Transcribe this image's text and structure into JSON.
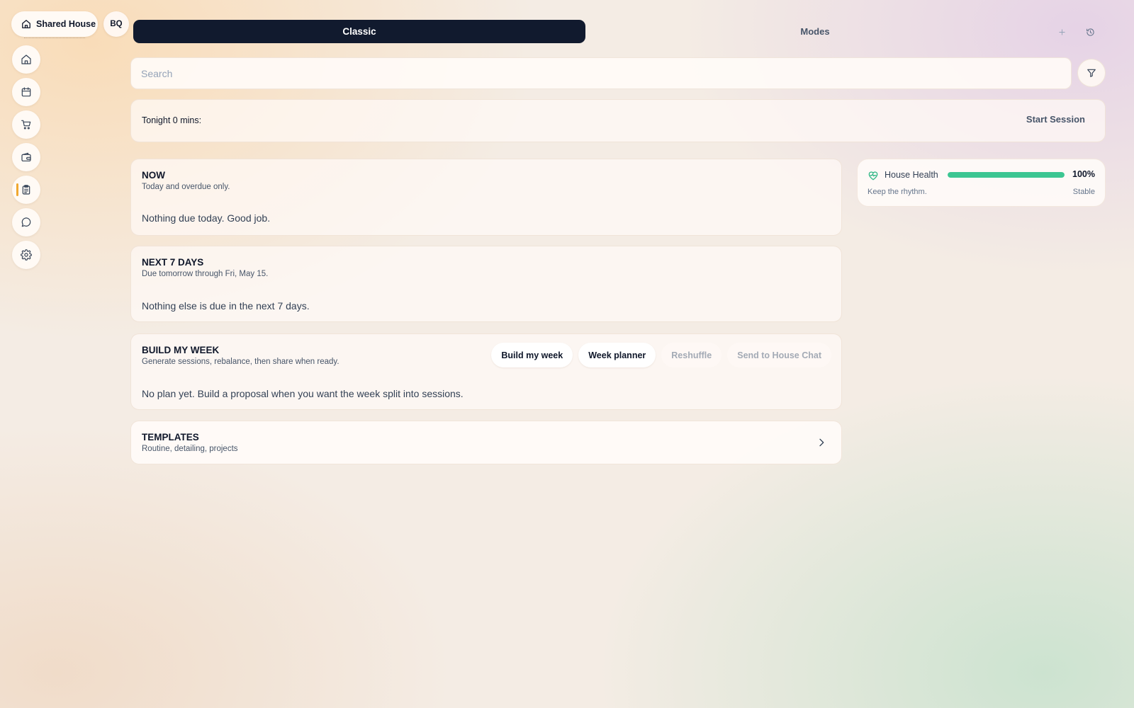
{
  "workspace": {
    "name": "Shared House",
    "avatar_initials": "BQ"
  },
  "sidebar": {
    "items": [
      {
        "id": "home",
        "icon": "home-icon",
        "active": false
      },
      {
        "id": "calendar",
        "icon": "calendar-icon",
        "active": false
      },
      {
        "id": "shopping",
        "icon": "cart-icon",
        "active": false
      },
      {
        "id": "wallet",
        "icon": "wallet-icon",
        "active": false
      },
      {
        "id": "chores",
        "icon": "clipboard-icon",
        "active": true
      },
      {
        "id": "chat",
        "icon": "chat-bubble-icon",
        "active": false
      },
      {
        "id": "settings",
        "icon": "gear-icon",
        "active": false
      }
    ],
    "active_indicator_color": "#f0a830"
  },
  "topbar": {
    "classic_label": "Classic",
    "modes_label": "Modes",
    "plus_icon": "plus-icon",
    "history_icon": "history-icon"
  },
  "search": {
    "placeholder": "Search",
    "value": "",
    "filter_icon": "filter-icon"
  },
  "tonight": {
    "label": "Tonight 0 mins:",
    "action_label": "Start Session"
  },
  "sections": {
    "now": {
      "title": "NOW",
      "subtitle": "Today and overdue only.",
      "body": "Nothing due today. Good job."
    },
    "next7": {
      "title": "NEXT 7 DAYS",
      "subtitle": "Due tomorrow through Fri, May 15.",
      "body": "Nothing else is due in the next 7 days."
    },
    "build": {
      "title": "BUILD MY WEEK",
      "subtitle": "Generate sessions, rebalance, then share when ready.",
      "body": "No plan yet. Build a proposal when you want the week split into sessions.",
      "actions": [
        {
          "label": "Build my week",
          "enabled": true
        },
        {
          "label": "Week planner",
          "enabled": true
        },
        {
          "label": "Reshuffle",
          "enabled": false
        },
        {
          "label": "Send to House Chat",
          "enabled": false
        }
      ]
    },
    "templates": {
      "title": "TEMPLATES",
      "subtitle": "Routine, detailing, projects",
      "chevron_icon": "chevron-right-icon"
    }
  },
  "house_health": {
    "label": "House Health",
    "icon": "heart-pulse-icon",
    "percent": 100,
    "percent_label": "100%",
    "note": "Keep the rhythm.",
    "status": "Stable",
    "bar_color": "#3cc692"
  },
  "colors": {
    "primary_dark": "#111a2e",
    "accent_amber": "#f0a830",
    "health_green": "#3cc692"
  }
}
